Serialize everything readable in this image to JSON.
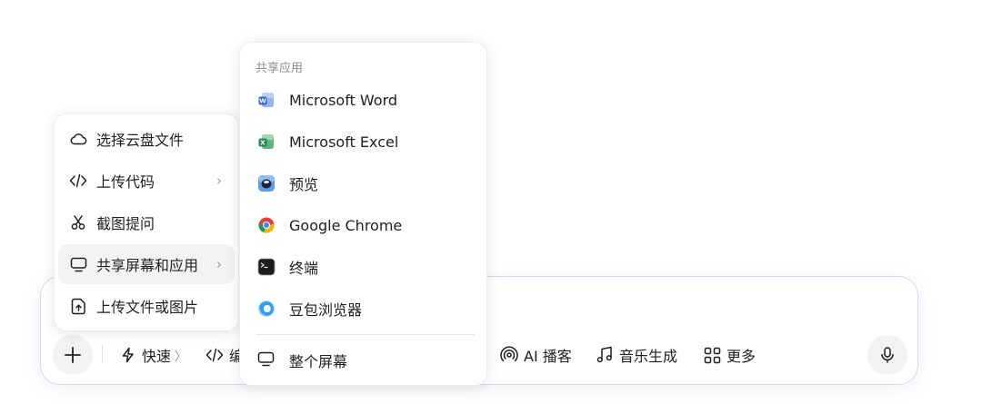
{
  "left_menu": {
    "items": [
      {
        "label": "选择云盘文件",
        "icon": "cloud-icon",
        "has_submenu": false
      },
      {
        "label": "上传代码",
        "icon": "code-icon",
        "has_submenu": true
      },
      {
        "label": "截图提问",
        "icon": "scissors-icon",
        "has_submenu": false
      },
      {
        "label": "共享屏幕和应用",
        "icon": "monitor-icon",
        "has_submenu": true,
        "active": true
      },
      {
        "label": "上传文件或图片",
        "icon": "upload-file-icon",
        "has_submenu": false
      }
    ]
  },
  "share_menu": {
    "section_title": "共享应用",
    "apps": [
      {
        "label": "Microsoft Word",
        "icon": "word-icon"
      },
      {
        "label": "Microsoft Excel",
        "icon": "excel-icon"
      },
      {
        "label": "预览",
        "icon": "preview-icon"
      },
      {
        "label": "Google Chrome",
        "icon": "chrome-icon"
      },
      {
        "label": "终端",
        "icon": "terminal-icon"
      },
      {
        "label": "豆包浏览器",
        "icon": "doubao-browser-icon"
      }
    ],
    "whole_screen_label": "整个屏幕"
  },
  "toolbar": {
    "quick_label": "快速",
    "code_label": "编",
    "podcast_label": "AI 播客",
    "music_label": "音乐生成",
    "more_label": "更多"
  },
  "colors": {
    "accent_border": "#cfdcf7",
    "word_blue": "#2b66c9",
    "excel_green": "#1f8a4c"
  }
}
